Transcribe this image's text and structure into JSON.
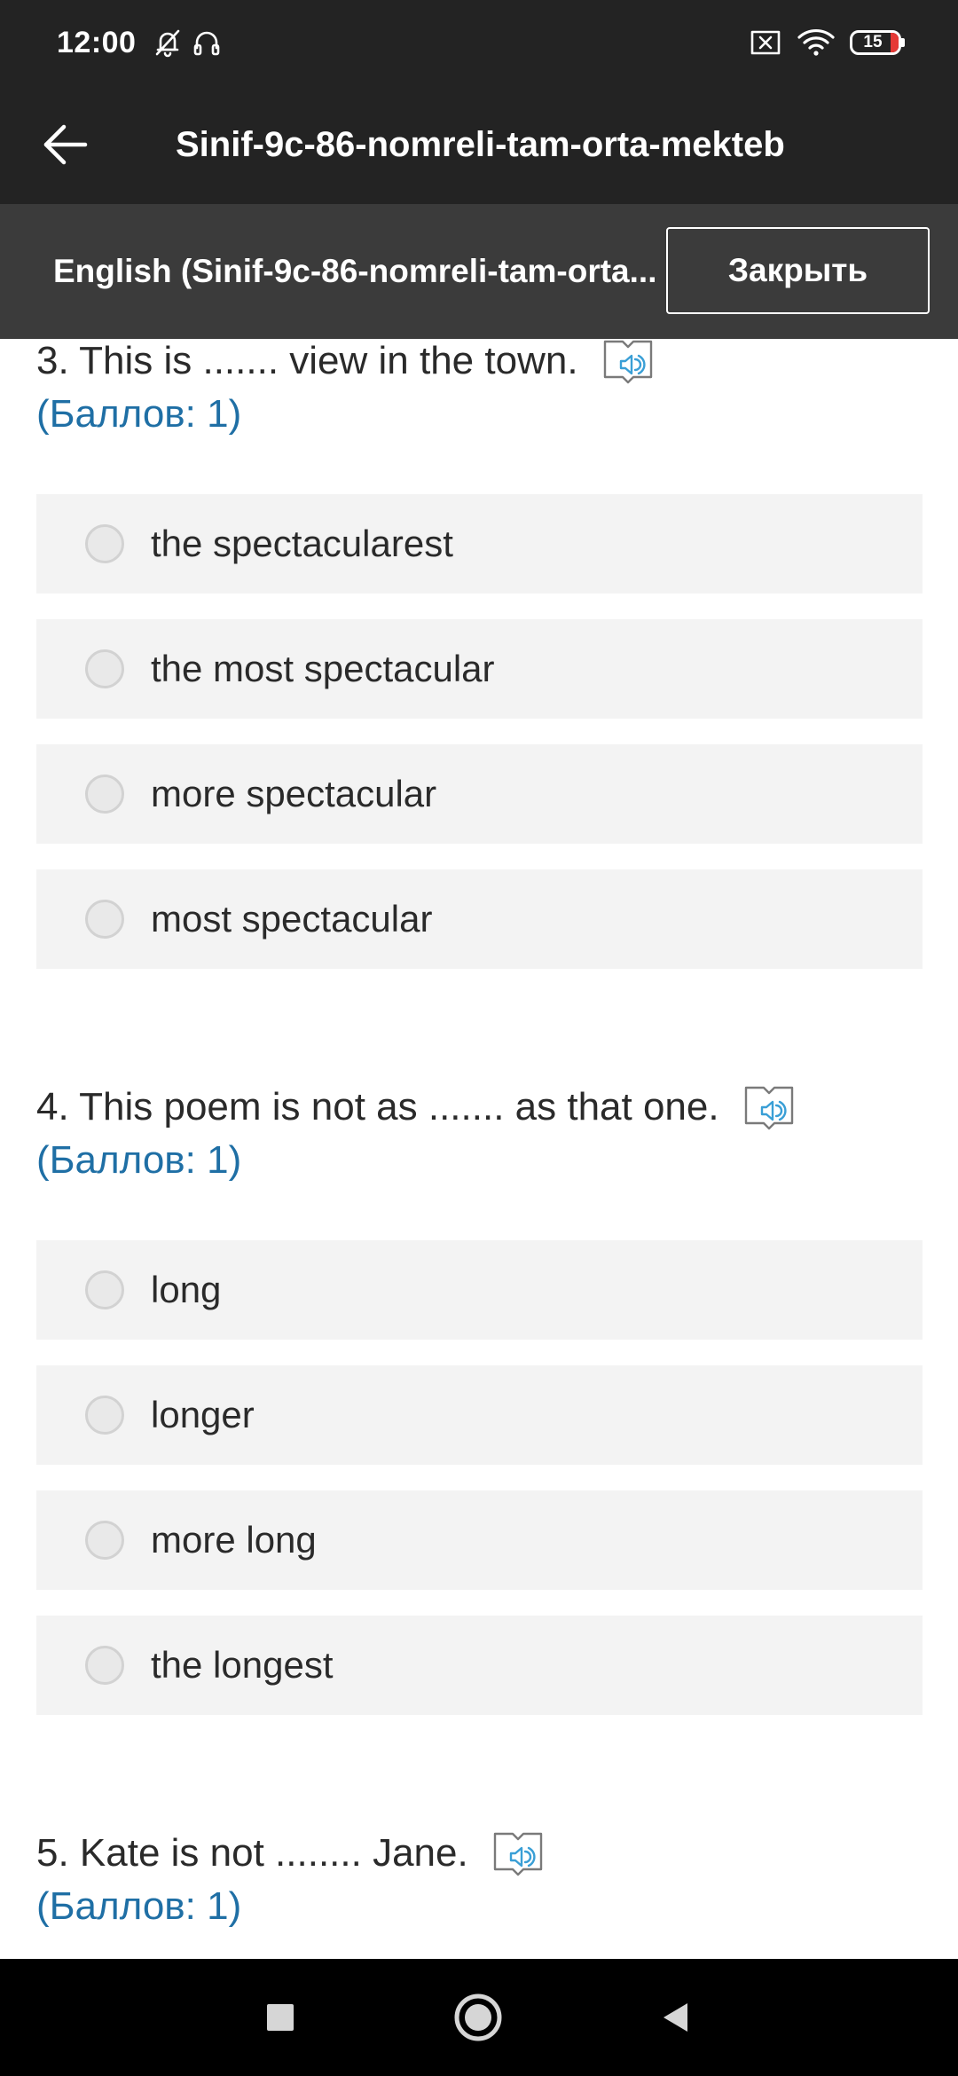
{
  "status_bar": {
    "time": "12:00",
    "battery_level": "15",
    "icons": [
      "bell-off-icon",
      "headphones-icon",
      "sim-off-icon",
      "wifi-icon",
      "battery-icon"
    ]
  },
  "app_bar": {
    "title": "Sinif-9c-86-nomreli-tam-orta-mekteb",
    "back_icon": "arrow-left-icon"
  },
  "sub_header": {
    "course_name": "English (Sinif-9c-86-nomreli-tam-orta...",
    "close_label": "Закрыть"
  },
  "questions": [
    {
      "text": "3. This is ....... view in the town.",
      "points": "(Баллов: 1)",
      "options": [
        "the spectacularest",
        "the most spectacular",
        "more spectacular",
        "most spectacular"
      ]
    },
    {
      "text": "4. This poem is not as ....... as that one.",
      "points": "(Баллов: 1)",
      "options": [
        "long",
        "longer",
        "more long",
        "the longest"
      ]
    },
    {
      "text": "5. Kate is not ........ Jane.",
      "points": "(Баллов: 1)",
      "options": []
    }
  ],
  "colors": {
    "header_bg": "#232323",
    "subheader_bg": "#3b3b3b",
    "points_text": "#1f6fa5",
    "option_bg": "#f3f3f3",
    "audio_icon_accent": "#3a9fd6"
  }
}
